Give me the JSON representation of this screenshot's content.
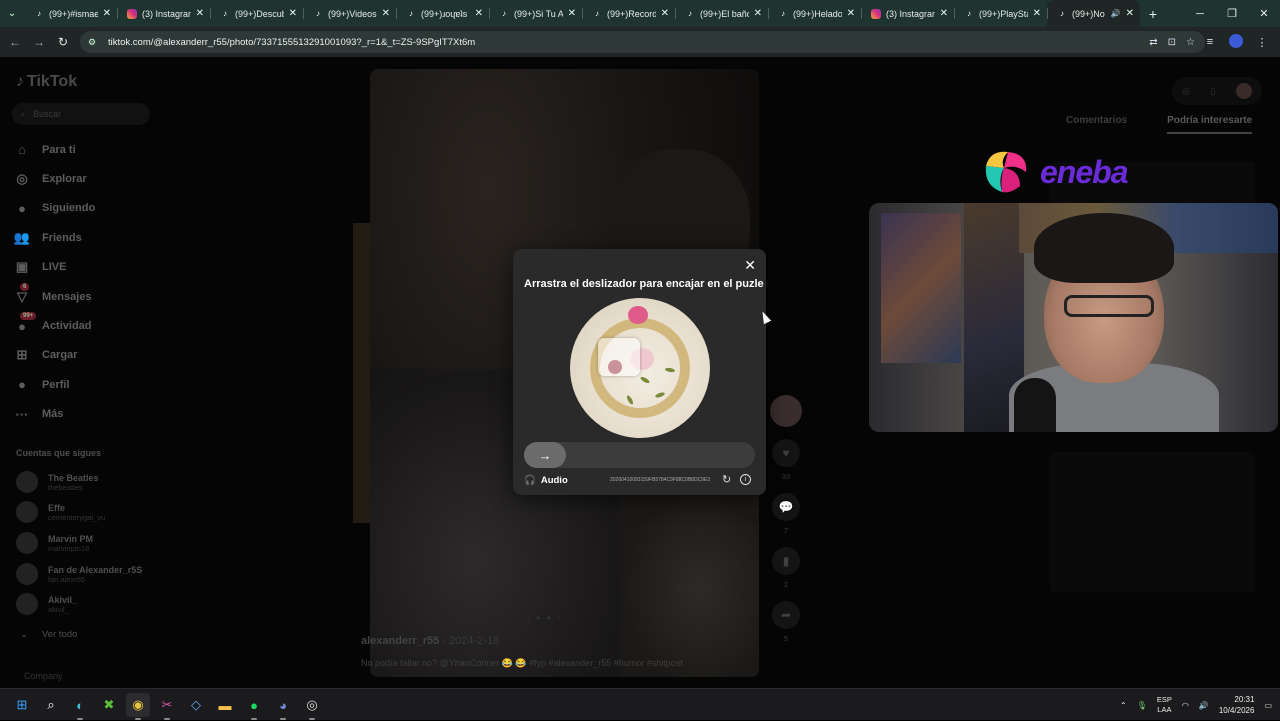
{
  "browser": {
    "tabs": [
      {
        "icon": "tiktok",
        "title": "(99+)#ismae"
      },
      {
        "icon": "instagram",
        "title": "(3) Instagram"
      },
      {
        "icon": "tiktok",
        "title": "(99+)Descub"
      },
      {
        "icon": "tiktok",
        "title": "(99+)Videos"
      },
      {
        "icon": "tiktok",
        "title": "(99+)ɹoɥɐʇs"
      },
      {
        "icon": "tiktok",
        "title": "(99+)Si Tu A"
      },
      {
        "icon": "tiktok",
        "title": "(99+)Record"
      },
      {
        "icon": "tiktok",
        "title": "(99+)El baño"
      },
      {
        "icon": "tiktok",
        "title": "(99+)Helado"
      },
      {
        "icon": "instagram",
        "title": "(3) Instagram"
      },
      {
        "icon": "tiktok",
        "title": "(99+)PlaySta"
      },
      {
        "icon": "tiktok",
        "title": "(99+)No",
        "active": true
      }
    ],
    "url": "tiktok.com/@alexanderr_r55/photo/7337155513291001093?_r=1&_t=ZS-9SPgIT7Xt6m"
  },
  "sidebar": {
    "logo": "TikTok",
    "search_placeholder": "Buscar",
    "nav": [
      {
        "icon": "home-icon",
        "glyph": "⌂",
        "label": "Para ti"
      },
      {
        "icon": "compass-icon",
        "glyph": "◎",
        "label": "Explorar"
      },
      {
        "icon": "following-icon",
        "glyph": "●",
        "label": "Siguiendo"
      },
      {
        "icon": "friends-icon",
        "glyph": "👥",
        "label": "Friends"
      },
      {
        "icon": "live-icon",
        "glyph": "▣",
        "label": "LIVE"
      },
      {
        "icon": "messages-icon",
        "glyph": "▽",
        "label": "Mensajes",
        "badge": "6"
      },
      {
        "icon": "activity-icon",
        "glyph": "●",
        "label": "Actividad",
        "badge": "99+"
      },
      {
        "icon": "upload-icon",
        "glyph": "⊞",
        "label": "Cargar"
      },
      {
        "icon": "profile-icon",
        "glyph": "●",
        "label": "Perfil"
      },
      {
        "icon": "more-icon",
        "glyph": "···",
        "label": "Más"
      }
    ],
    "following_title": "Cuentas que sigues",
    "following": [
      {
        "name": "The Beatles",
        "handle": "thebeatles"
      },
      {
        "name": "Effe",
        "handle": "cementerygal_vu"
      },
      {
        "name": "Marvin PM",
        "handle": "marvinpm18"
      },
      {
        "name": "Fan de Alexander_r5S",
        "handle": "fan.alexr55"
      },
      {
        "name": "Akivil_",
        "handle": "akivil_"
      }
    ],
    "see_all": "Ver todo",
    "company": "Company"
  },
  "post": {
    "username": "alexanderr_r55",
    "date": "· 2024-2-18",
    "caption": "No podía fallar no? @YhanConner 😂 😂 #fyp #alexander_r55 #humor #shitpost",
    "likes": "33",
    "comments": "7",
    "saves": "2",
    "shares": "5"
  },
  "right": {
    "tab_comments": "Comentarios",
    "tab_interest": "Podría interesarte"
  },
  "overlay": {
    "brand": "eneba"
  },
  "captcha": {
    "title": "Arrastra el deslizador para encajar en el puzle",
    "audio_label": "Audio",
    "id": "20260410093159FB5784C9F88C0B8DC9E3"
  },
  "taskbar": {
    "lang_top": "ESP",
    "lang_bottom": "LAA",
    "time": "20:31",
    "date": "10/4/2026"
  }
}
